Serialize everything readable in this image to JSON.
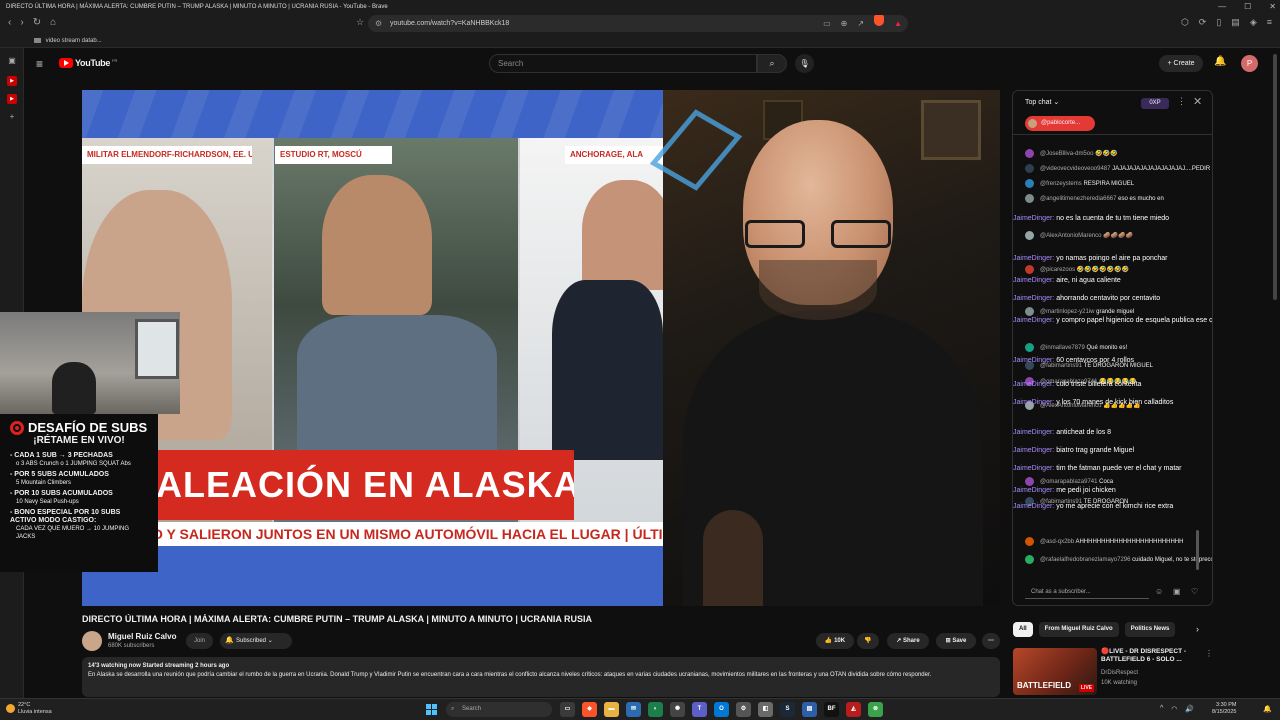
{
  "window": {
    "title": "DIRECTO ÚLTIMA HORA | MÁXIMA ALERTA: CUMBRE PUTIN – TRUMP ALASKA | MINUTO A MINUTO | UCRANIA RUSIA - YouTube - Brave",
    "controls": [
      "—",
      "☐",
      "✕"
    ]
  },
  "browser": {
    "url": "youtube.com/watch?v=KaNHBBKck18",
    "bookmark": "video stream datab..."
  },
  "youtube": {
    "logo": "YouTube",
    "country": "FR",
    "search_placeholder": "Search",
    "create_label": "Create",
    "avatar_letter": "P"
  },
  "video_overlay": {
    "loc_left": "MILITAR ELMENDORF-RICHARDSON, EE. UU.",
    "loc_center": "ESTUDIO RT, MOSCÚ",
    "loc_right": "ANCHORAGE, ALA",
    "banner": "ALEACIÓN EN ALASKA",
    "sub_banner": "O Y SALIERON JUNTOS EN UN MISMO AUTOMÓVIL HACIA EL LUGAR | ÚLTIMO"
  },
  "challenge": {
    "title": "DESAFÍO DE SUBS",
    "subtitle": "¡RÉTAME EN VIVO!",
    "rules": [
      {
        "main": "- CADA 1 SUB → 3 PECHADAS",
        "detail": "o 3 ABS Crunch o 1 JUMPING SQUAT Abs"
      },
      {
        "main": "- POR 5 SUBS ACUMULADOS",
        "detail": "5 Mountain Climbers"
      },
      {
        "main": "- POR 10 SUBS ACUMULADOS",
        "detail": "10 Navy Seal Push-ups"
      },
      {
        "main": "- BONO ESPECIAL POR 10 SUBS ACTIVO MODO CASTIGO:",
        "detail": "CADA VEZ QUE MUERO → 10 JUMPING JACKS"
      }
    ]
  },
  "video_info": {
    "title": "DIRECTO ÚLTIMA HORA | MÁXIMA ALERTA: CUMBRE PUTIN – TRUMP ALASKA | MINUTO A MINUTO | UCRANIA RUSIA",
    "channel": "Miguel Ruiz Calvo",
    "subscribers": "680K subscribers",
    "join": "Join",
    "subscribed": "Subscribed",
    "likes": "10K",
    "share": "Share",
    "save": "Save",
    "watching": "14'3",
    "desc_meta": "watching now  Started streaming 2 hours ago",
    "description": "En Alaska se desarrolla una reunión que podría cambiar el rumbo de la guerra en Ucrania. Donald Trump y Vladimir Putin se encuentran cara a cara mientras el conflicto alcanza niveles críticos: ataques en varias ciudades ucranianas, movimientos militares en las fronteras y una OTAN dividida sobre cómo responder."
  },
  "chat": {
    "header": "Top chat",
    "xp": "0XP",
    "user_pill": "@pablocorte...",
    "messages": [
      {
        "name": "@JoseBlliva-dm5oo",
        "text": "🤣🤣🤣",
        "color": "#8e44ad"
      },
      {
        "name": "@videovecvideoveoo9487",
        "text": "JAJAJAJAJAJAJAJAJAJAJ....PEDIR ES GRATIS",
        "color": "#2c3e50"
      },
      {
        "name": "@frenzeystems",
        "text": "RESPIRA MIGUEL",
        "color": "#2980b9"
      },
      {
        "name": "@angelitimenezheredia6667",
        "text": "eso es mucho en",
        "color": "#7f8c8d"
      },
      {
        "name": "@AlexAntonioMarenco",
        "text": "🥔🥔🥔🥔",
        "color": "#95a5a6"
      },
      {
        "name": "@picarezoos",
        "text": "🤣🤣🤣🤣🤣🤣🤣",
        "color": "#c0392b"
      },
      {
        "name": "@martinlopez-y21iw",
        "text": "grande miguel",
        "color": "#7f8c8d"
      },
      {
        "name": "@inmallave7879",
        "text": "Qué monito es!",
        "color": "#16a085"
      },
      {
        "name": "@fabimartins91",
        "text": "TE DROGARON MIGUEL",
        "color": "#34495e"
      },
      {
        "name": "@omarapablaza9741",
        "text": "😂😂😂😂😂",
        "color": "#8e44ad"
      },
      {
        "name": "@AlexAntonioMarenco",
        "text": "👍👍👍👍👍",
        "color": "#95a5a6"
      },
      {
        "name": "@omarapablaza9741",
        "text": "Coca",
        "color": "#8e44ad"
      },
      {
        "name": "@fabimartins91",
        "text": "TE DROGARON",
        "color": "#34495e"
      },
      {
        "name": "@asd-qx2bb",
        "text": "AHHHHHHHHHHHHHHHHHHHHHHHH",
        "color": "#d35400"
      },
      {
        "name": "@rafaelalfredobranezlamayo7296",
        "text": "cuidado Miguel, no te stoprecon tanta risa....jjjjj",
        "color": "#27ae60"
      }
    ],
    "overlay": [
      {
        "name": "JaimeDinger:",
        "text": "no es la cuenta de tu tm tiene miedo"
      },
      {
        "name": "JaimeDinger:",
        "text": "yo namas poingo el aire pa ponchar"
      },
      {
        "name": "JaimeDinger:",
        "text": "aire, ni agua caliente"
      },
      {
        "name": "JaimeDinger:",
        "text": "ahorrando centavito por centavito"
      },
      {
        "name": "JaimeDinger:",
        "text": "y compro papel higienico de esquela publica ese que es casi que transparente"
      },
      {
        "name": "JaimeDinger:",
        "text": "60 centavcos por 4 rollos"
      },
      {
        "name": "JaimeDinger:",
        "text": "culo triste billetera contenta"
      },
      {
        "name": "JaimeDinger:",
        "text": "y los 70 manes de kick bien calladitos"
      },
      {
        "name": "JaimeDinger:",
        "text": "anticheat de los 8"
      },
      {
        "name": "JaimeDinger:",
        "text": "biatro trag grande Miguel"
      },
      {
        "name": "JaimeDinger:",
        "text": "tim the fatman puede ver el chat y matar"
      },
      {
        "name": "JaimeDinger:",
        "text": "me pedi joi chicken"
      },
      {
        "name": "JaimeDinger:",
        "text": "yo me aprecie con el kimchi rice extra"
      }
    ],
    "input_placeholder": "Chat as a subscriber..."
  },
  "recommendations": {
    "chips": [
      "All",
      "From Miguel Ruiz Calvo",
      "Politics News"
    ],
    "item": {
      "title": "🔴LIVE - DR DISRESPECT - BATTLEFIELD 6 - SOLO ...",
      "channel": "DrDisRespect",
      "watching": "10K watching",
      "thumb_text": "BATTLEFIELD",
      "live": "LIVE"
    }
  },
  "taskbar": {
    "temp": "22°C",
    "weather": "Lluvia intensa",
    "search": "Search",
    "time": "3:30 PM",
    "date": "8/15/2025"
  }
}
